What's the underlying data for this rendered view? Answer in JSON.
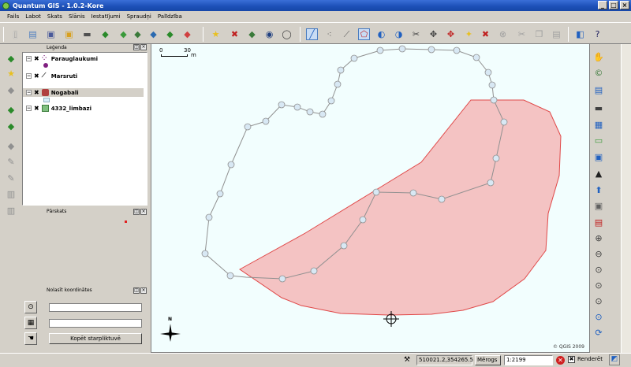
{
  "window": {
    "title": "Quantum GIS - 1.0.2-Kore"
  },
  "menu": [
    "Fails",
    "Labot",
    "Skats",
    "Slānis",
    "Iestatījumi",
    "Spraudņi",
    "Palīdzība"
  ],
  "legend": {
    "title": "Leģenda",
    "layers": [
      {
        "name": "Parauglaukumi",
        "selected": false
      },
      {
        "name": "Marsruti",
        "selected": false
      },
      {
        "name": "Nogabali",
        "selected": true
      },
      {
        "name": "4332_limbazi",
        "selected": false
      }
    ]
  },
  "overview": {
    "title": "Pārskats"
  },
  "coords_panel": {
    "title": "Nolasīt koordinātes",
    "copy_label": "Kopēt starpliktuvē"
  },
  "map": {
    "scale_zero": "0",
    "scale_end": "30",
    "scale_unit": "m",
    "north_label": "N",
    "copyright": "© QGIS 2009",
    "colors": {
      "background": "#f2fefe",
      "polygon_fill": "#f4b8b8",
      "polygon_stroke": "#e04848",
      "route_stroke": "#909090",
      "vertex_fill": "#d8e8f4"
    }
  },
  "status": {
    "coordinates": "510021.2,354265.5",
    "scale_label": "Mērogs",
    "scale_value": "1:2199",
    "render_label": "Renderēt"
  }
}
